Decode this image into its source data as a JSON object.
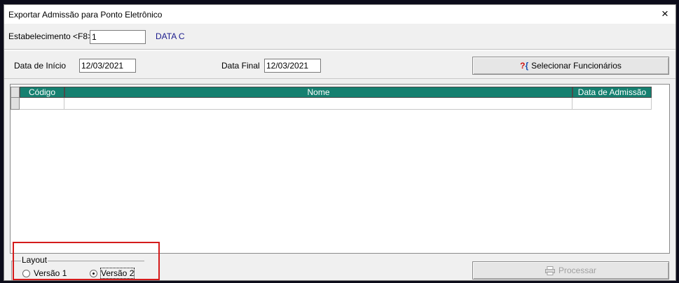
{
  "window": {
    "title": "Exportar Admissão para Ponto Eletrônico",
    "close_icon": "×"
  },
  "establishment": {
    "label": "Estabelecimento <F8>",
    "value": "1",
    "company_name": "DATA C"
  },
  "dates": {
    "start_label": "Data de Início",
    "start_value": "12/03/2021",
    "end_label": "Data Final",
    "end_value": "12/03/2021"
  },
  "select_employees_button": {
    "icon_q": "?",
    "icon_br": "{",
    "label": "Selecionar Funcionários"
  },
  "grid": {
    "columns": [
      "Código",
      "Nome",
      "Data de Admissão"
    ],
    "rows": [
      [
        "",
        "",
        ""
      ]
    ]
  },
  "layout_group": {
    "legend": "Layout",
    "options": [
      {
        "label": "Versão 1",
        "checked": false
      },
      {
        "label": "Versão 2",
        "checked": true
      }
    ]
  },
  "process_button": {
    "icon": "printer-icon",
    "label": "Processar",
    "enabled": false
  },
  "colors": {
    "grid_header": "#158070",
    "highlight": "#d41b1b",
    "company_text": "#1a1a8c"
  }
}
